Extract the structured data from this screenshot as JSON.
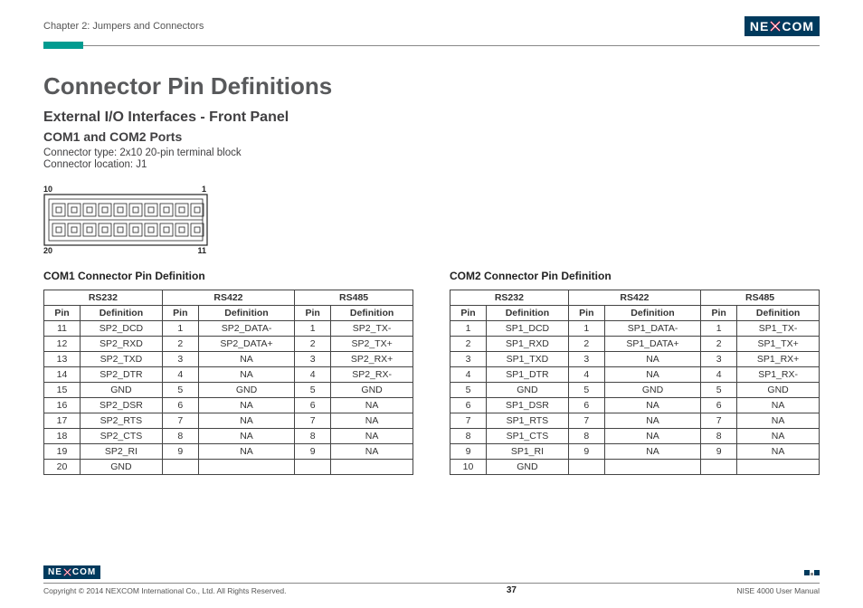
{
  "header": {
    "chapter": "Chapter 2: Jumpers and Connectors",
    "brand": "NEXCOM"
  },
  "title": "Connector Pin Definitions",
  "subtitle1": "External I/O Interfaces - Front Panel",
  "subtitle2": "COM1 and COM2 Ports",
  "meta1": "Connector type: 2x10 20-pin terminal block",
  "meta2": "Connector location: J1",
  "diagram_labels": {
    "tl": "10",
    "tr": "1",
    "bl": "20",
    "br": "11"
  },
  "table_groups": [
    "RS232",
    "RS422",
    "RS485"
  ],
  "col_pin": "Pin",
  "col_def": "Definition",
  "com1": {
    "title": "COM1 Connector Pin Definition",
    "rows": [
      {
        "p1": "11",
        "d1": "SP2_DCD",
        "p2": "1",
        "d2": "SP2_DATA-",
        "p3": "1",
        "d3": "SP2_TX-"
      },
      {
        "p1": "12",
        "d1": "SP2_RXD",
        "p2": "2",
        "d2": "SP2_DATA+",
        "p3": "2",
        "d3": "SP2_TX+"
      },
      {
        "p1": "13",
        "d1": "SP2_TXD",
        "p2": "3",
        "d2": "NA",
        "p3": "3",
        "d3": "SP2_RX+"
      },
      {
        "p1": "14",
        "d1": "SP2_DTR",
        "p2": "4",
        "d2": "NA",
        "p3": "4",
        "d3": "SP2_RX-"
      },
      {
        "p1": "15",
        "d1": "GND",
        "p2": "5",
        "d2": "GND",
        "p3": "5",
        "d3": "GND"
      },
      {
        "p1": "16",
        "d1": "SP2_DSR",
        "p2": "6",
        "d2": "NA",
        "p3": "6",
        "d3": "NA"
      },
      {
        "p1": "17",
        "d1": "SP2_RTS",
        "p2": "7",
        "d2": "NA",
        "p3": "7",
        "d3": "NA"
      },
      {
        "p1": "18",
        "d1": "SP2_CTS",
        "p2": "8",
        "d2": "NA",
        "p3": "8",
        "d3": "NA"
      },
      {
        "p1": "19",
        "d1": "SP2_RI",
        "p2": "9",
        "d2": "NA",
        "p3": "9",
        "d3": "NA"
      },
      {
        "p1": "20",
        "d1": "GND",
        "p2": "",
        "d2": "",
        "p3": "",
        "d3": ""
      }
    ]
  },
  "com2": {
    "title": "COM2 Connector Pin Definition",
    "rows": [
      {
        "p1": "1",
        "d1": "SP1_DCD",
        "p2": "1",
        "d2": "SP1_DATA-",
        "p3": "1",
        "d3": "SP1_TX-"
      },
      {
        "p1": "2",
        "d1": "SP1_RXD",
        "p2": "2",
        "d2": "SP1_DATA+",
        "p3": "2",
        "d3": "SP1_TX+"
      },
      {
        "p1": "3",
        "d1": "SP1_TXD",
        "p2": "3",
        "d2": "NA",
        "p3": "3",
        "d3": "SP1_RX+"
      },
      {
        "p1": "4",
        "d1": "SP1_DTR",
        "p2": "4",
        "d2": "NA",
        "p3": "4",
        "d3": "SP1_RX-"
      },
      {
        "p1": "5",
        "d1": "GND",
        "p2": "5",
        "d2": "GND",
        "p3": "5",
        "d3": "GND"
      },
      {
        "p1": "6",
        "d1": "SP1_DSR",
        "p2": "6",
        "d2": "NA",
        "p3": "6",
        "d3": "NA"
      },
      {
        "p1": "7",
        "d1": "SP1_RTS",
        "p2": "7",
        "d2": "NA",
        "p3": "7",
        "d3": "NA"
      },
      {
        "p1": "8",
        "d1": "SP1_CTS",
        "p2": "8",
        "d2": "NA",
        "p3": "8",
        "d3": "NA"
      },
      {
        "p1": "9",
        "d1": "SP1_RI",
        "p2": "9",
        "d2": "NA",
        "p3": "9",
        "d3": "NA"
      },
      {
        "p1": "10",
        "d1": "GND",
        "p2": "",
        "d2": "",
        "p3": "",
        "d3": ""
      }
    ]
  },
  "footer": {
    "copyright": "Copyright © 2014 NEXCOM International Co., Ltd. All Rights Reserved.",
    "page": "37",
    "manual": "NISE 4000 User Manual"
  }
}
